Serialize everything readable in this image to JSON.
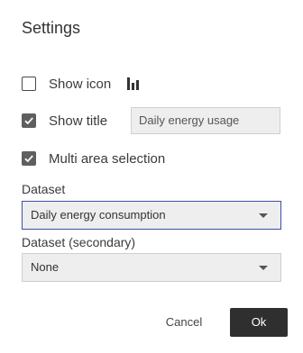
{
  "dialog": {
    "title": "Settings"
  },
  "options": {
    "show_icon": {
      "label": "Show icon",
      "checked": false,
      "icon": "bar-chart-icon"
    },
    "show_title": {
      "label": "Show title",
      "checked": true,
      "value": "Daily energy usage"
    },
    "multi_area": {
      "label": "Multi area selection",
      "checked": true
    }
  },
  "dataset": {
    "label": "Dataset",
    "selected": "Daily energy consumption"
  },
  "dataset_secondary": {
    "label": "Dataset (secondary)",
    "selected": "None"
  },
  "actions": {
    "cancel_label": "Cancel",
    "ok_label": "Ok"
  },
  "colors": {
    "focus_border": "#3b4fa8",
    "primary_button": "#2f2f2f"
  }
}
